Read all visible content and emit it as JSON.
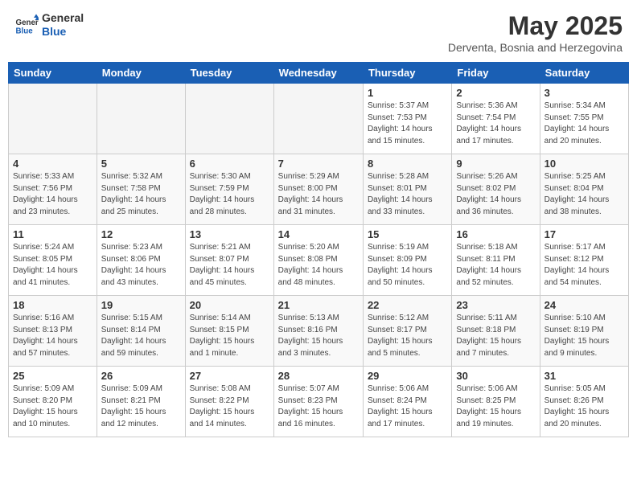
{
  "header": {
    "logo_line1": "General",
    "logo_line2": "Blue",
    "month": "May 2025",
    "location": "Derventa, Bosnia and Herzegovina"
  },
  "weekdays": [
    "Sunday",
    "Monday",
    "Tuesday",
    "Wednesday",
    "Thursday",
    "Friday",
    "Saturday"
  ],
  "weeks": [
    [
      {
        "day": "",
        "info": ""
      },
      {
        "day": "",
        "info": ""
      },
      {
        "day": "",
        "info": ""
      },
      {
        "day": "",
        "info": ""
      },
      {
        "day": "1",
        "info": "Sunrise: 5:37 AM\nSunset: 7:53 PM\nDaylight: 14 hours\nand 15 minutes."
      },
      {
        "day": "2",
        "info": "Sunrise: 5:36 AM\nSunset: 7:54 PM\nDaylight: 14 hours\nand 17 minutes."
      },
      {
        "day": "3",
        "info": "Sunrise: 5:34 AM\nSunset: 7:55 PM\nDaylight: 14 hours\nand 20 minutes."
      }
    ],
    [
      {
        "day": "4",
        "info": "Sunrise: 5:33 AM\nSunset: 7:56 PM\nDaylight: 14 hours\nand 23 minutes."
      },
      {
        "day": "5",
        "info": "Sunrise: 5:32 AM\nSunset: 7:58 PM\nDaylight: 14 hours\nand 25 minutes."
      },
      {
        "day": "6",
        "info": "Sunrise: 5:30 AM\nSunset: 7:59 PM\nDaylight: 14 hours\nand 28 minutes."
      },
      {
        "day": "7",
        "info": "Sunrise: 5:29 AM\nSunset: 8:00 PM\nDaylight: 14 hours\nand 31 minutes."
      },
      {
        "day": "8",
        "info": "Sunrise: 5:28 AM\nSunset: 8:01 PM\nDaylight: 14 hours\nand 33 minutes."
      },
      {
        "day": "9",
        "info": "Sunrise: 5:26 AM\nSunset: 8:02 PM\nDaylight: 14 hours\nand 36 minutes."
      },
      {
        "day": "10",
        "info": "Sunrise: 5:25 AM\nSunset: 8:04 PM\nDaylight: 14 hours\nand 38 minutes."
      }
    ],
    [
      {
        "day": "11",
        "info": "Sunrise: 5:24 AM\nSunset: 8:05 PM\nDaylight: 14 hours\nand 41 minutes."
      },
      {
        "day": "12",
        "info": "Sunrise: 5:23 AM\nSunset: 8:06 PM\nDaylight: 14 hours\nand 43 minutes."
      },
      {
        "day": "13",
        "info": "Sunrise: 5:21 AM\nSunset: 8:07 PM\nDaylight: 14 hours\nand 45 minutes."
      },
      {
        "day": "14",
        "info": "Sunrise: 5:20 AM\nSunset: 8:08 PM\nDaylight: 14 hours\nand 48 minutes."
      },
      {
        "day": "15",
        "info": "Sunrise: 5:19 AM\nSunset: 8:09 PM\nDaylight: 14 hours\nand 50 minutes."
      },
      {
        "day": "16",
        "info": "Sunrise: 5:18 AM\nSunset: 8:11 PM\nDaylight: 14 hours\nand 52 minutes."
      },
      {
        "day": "17",
        "info": "Sunrise: 5:17 AM\nSunset: 8:12 PM\nDaylight: 14 hours\nand 54 minutes."
      }
    ],
    [
      {
        "day": "18",
        "info": "Sunrise: 5:16 AM\nSunset: 8:13 PM\nDaylight: 14 hours\nand 57 minutes."
      },
      {
        "day": "19",
        "info": "Sunrise: 5:15 AM\nSunset: 8:14 PM\nDaylight: 14 hours\nand 59 minutes."
      },
      {
        "day": "20",
        "info": "Sunrise: 5:14 AM\nSunset: 8:15 PM\nDaylight: 15 hours\nand 1 minute."
      },
      {
        "day": "21",
        "info": "Sunrise: 5:13 AM\nSunset: 8:16 PM\nDaylight: 15 hours\nand 3 minutes."
      },
      {
        "day": "22",
        "info": "Sunrise: 5:12 AM\nSunset: 8:17 PM\nDaylight: 15 hours\nand 5 minutes."
      },
      {
        "day": "23",
        "info": "Sunrise: 5:11 AM\nSunset: 8:18 PM\nDaylight: 15 hours\nand 7 minutes."
      },
      {
        "day": "24",
        "info": "Sunrise: 5:10 AM\nSunset: 8:19 PM\nDaylight: 15 hours\nand 9 minutes."
      }
    ],
    [
      {
        "day": "25",
        "info": "Sunrise: 5:09 AM\nSunset: 8:20 PM\nDaylight: 15 hours\nand 10 minutes."
      },
      {
        "day": "26",
        "info": "Sunrise: 5:09 AM\nSunset: 8:21 PM\nDaylight: 15 hours\nand 12 minutes."
      },
      {
        "day": "27",
        "info": "Sunrise: 5:08 AM\nSunset: 8:22 PM\nDaylight: 15 hours\nand 14 minutes."
      },
      {
        "day": "28",
        "info": "Sunrise: 5:07 AM\nSunset: 8:23 PM\nDaylight: 15 hours\nand 16 minutes."
      },
      {
        "day": "29",
        "info": "Sunrise: 5:06 AM\nSunset: 8:24 PM\nDaylight: 15 hours\nand 17 minutes."
      },
      {
        "day": "30",
        "info": "Sunrise: 5:06 AM\nSunset: 8:25 PM\nDaylight: 15 hours\nand 19 minutes."
      },
      {
        "day": "31",
        "info": "Sunrise: 5:05 AM\nSunset: 8:26 PM\nDaylight: 15 hours\nand 20 minutes."
      }
    ]
  ]
}
